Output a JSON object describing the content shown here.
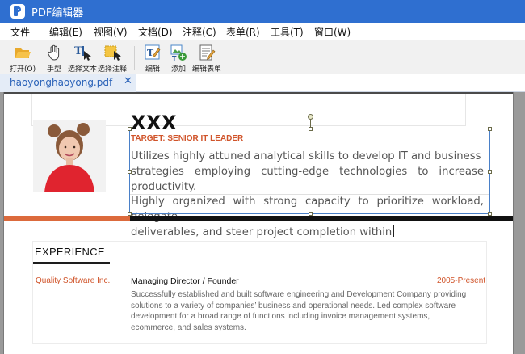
{
  "app": {
    "title": "PDF编辑器"
  },
  "menu": [
    "文件",
    "编辑(E)",
    "视图(V)",
    "文档(D)",
    "注释(C)",
    "表单(R)",
    "工具(T)",
    "窗口(W)"
  ],
  "toolbar": {
    "open": "打开(O)",
    "hand": "手型",
    "select_text": "选择文本",
    "select_annotation": "选择注释",
    "edit": "编辑",
    "add": "添加",
    "edit_form": "编辑表单"
  },
  "tab": {
    "filename": "haoyonghaoyong.pdf",
    "close": "✕"
  },
  "resume": {
    "name": "XXX",
    "target": "TARGET: SENIOR IT LEADER",
    "summary_lines": [
      "Utilizes highly attuned analytical skills to develop IT and business",
      "strategies employing cutting-edge technologies to increase productivity.",
      "Highly organized with strong capacity to prioritize workload, delegate",
      "deliverables, and steer project completion within"
    ],
    "experience": {
      "title": "EXPERIENCE",
      "company": "Quality Software Inc.",
      "role": "Managing Director / Founder",
      "period": "2005-Present",
      "description_lines": [
        "Successfully established and built software engineering and Development Company providing",
        "solutions to a variety of companies’ business and operational needs. Led complex software",
        "development for a broad range of functions including invoice management systems,",
        "ecommerce, and sales systems."
      ]
    }
  },
  "colors": {
    "titlebar": "#2f6fd0",
    "accent_orange": "#d0542a",
    "band_orange": "#dc6a3c",
    "band_black": "#111111",
    "selection": "#4a80c8"
  },
  "icons": [
    "app-logo-icon",
    "folder-open-icon",
    "hand-icon",
    "select-text-icon",
    "select-annotation-icon",
    "edit-text-icon",
    "add-image-icon",
    "edit-form-icon",
    "close-icon"
  ]
}
